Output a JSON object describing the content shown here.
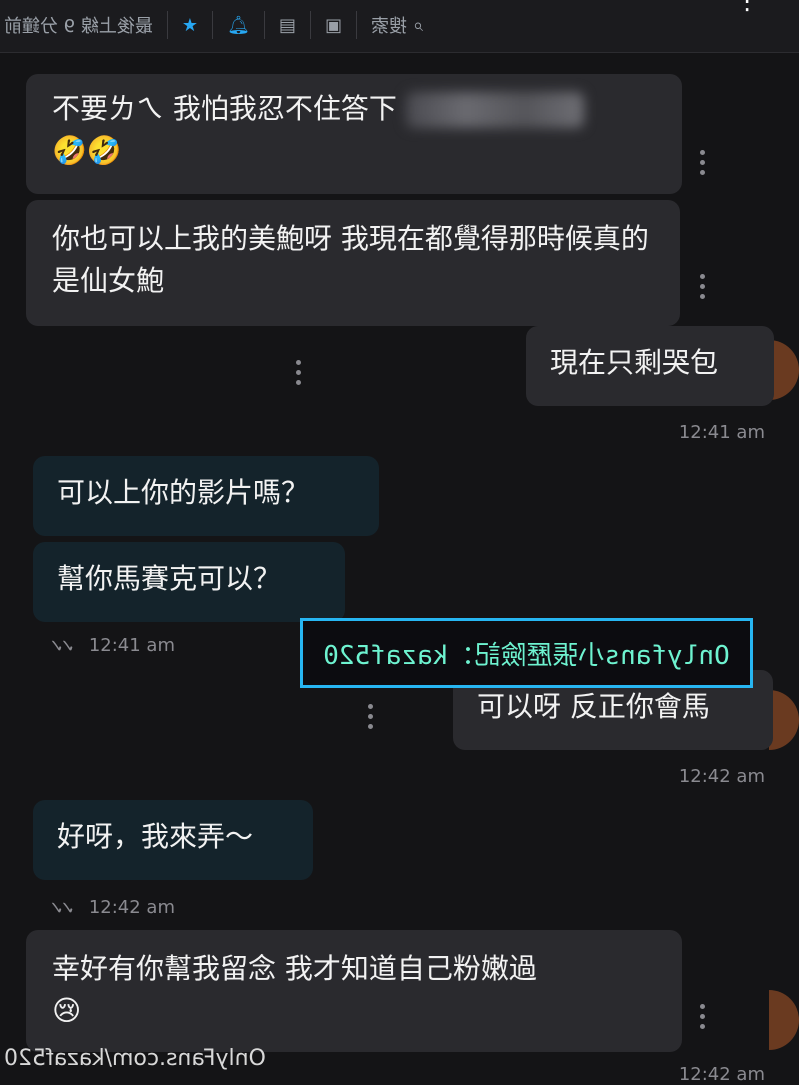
{
  "header": {
    "last_seen": "最後上線 9 分鐘前",
    "search_label": "搜索"
  },
  "messages": [
    {
      "text_before_blur": "不要ㄌㄟ 我怕我忍不住答下",
      "emoji": "🤣🤣"
    },
    {
      "text": "你也可以上我的美鮑呀 我現在都覺得那時候真的是仙女鮑"
    },
    {
      "text": "現在只剩哭包"
    },
    {
      "time": "12:41 am"
    },
    {
      "text": "可以上你的影片嗎？"
    },
    {
      "text": "幫你馬賽克可以？"
    },
    {
      "time": "12:41 am"
    },
    {
      "text": "可以呀 反正你會馬"
    },
    {
      "time": "12:42 am"
    },
    {
      "text": "好呀，我來弄～"
    },
    {
      "time": "12:42 am"
    },
    {
      "text": "幸好有你幫我留念 我才知道自己粉嫩過",
      "emoji": "😢"
    },
    {
      "time": "12:42 am"
    }
  ],
  "overlay": {
    "watermark": "Onlyfans小張歷險記：kazaf520",
    "site": "OnlyFans.com/kazaf520"
  },
  "colors": {
    "accent": "#27a7f2",
    "incoming": "#2a2a2e",
    "outgoing": "#14232b"
  }
}
